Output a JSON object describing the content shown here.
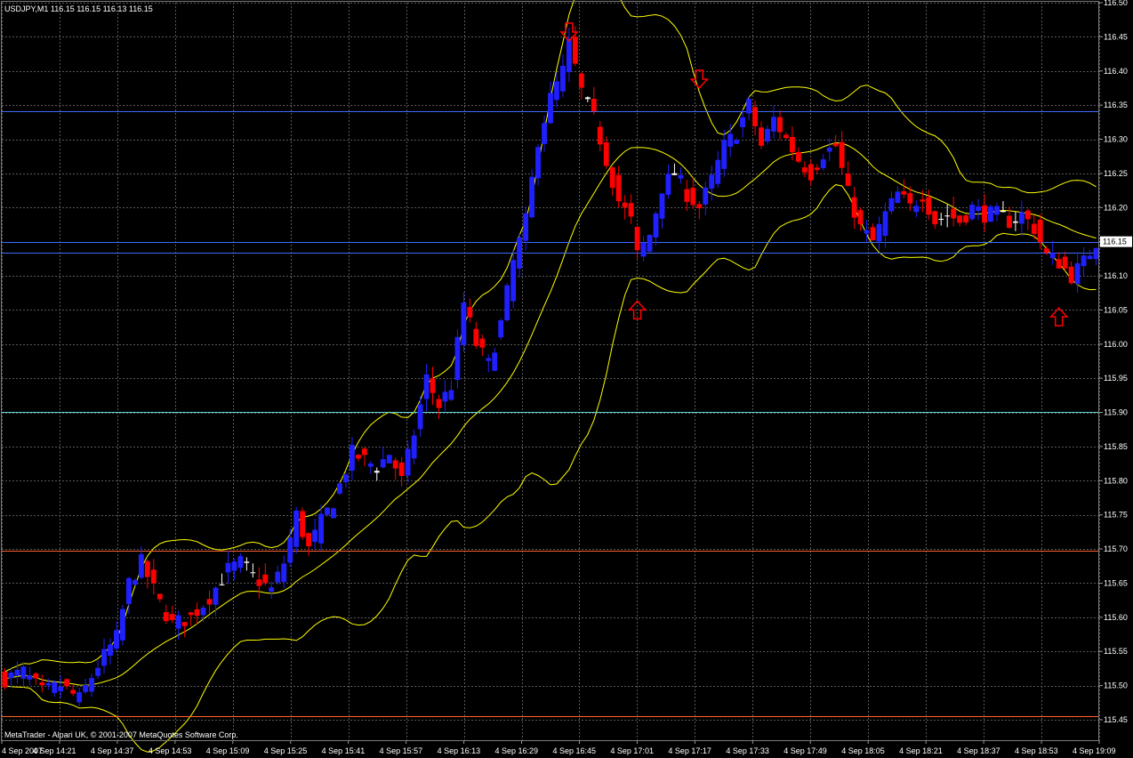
{
  "symbol_header": {
    "text": "USDJPY,M1  116.15 116.15 116.13 116.15"
  },
  "copyright": "MetaTrader - Alpari UK, © 2001-2007 MetaQuotes Software Corp.",
  "current_price_label": "116.15",
  "colors": {
    "background": "#000000",
    "grid": "#5a5a5a",
    "bull_candle": "#2020ff",
    "bear_candle": "#ff0000",
    "doji_candle": "#ffffff",
    "bollinger": "#ffff00",
    "blue_level": "#3d6cff",
    "cyan_level": "#5fd5d5",
    "orange_level": "#ff6030",
    "arrow": "#ff0000",
    "axis_text": "#ffffff"
  },
  "chart_data": {
    "type": "candlestick",
    "ylim": [
      115.42,
      116.5
    ],
    "y_ticks": [
      "116.50",
      "116.45",
      "116.40",
      "116.35",
      "116.30",
      "116.25",
      "116.20",
      "116.15",
      "116.10",
      "116.05",
      "116.00",
      "115.95",
      "115.90",
      "115.85",
      "115.80",
      "115.75",
      "115.70",
      "115.65",
      "115.60",
      "115.55",
      "115.50",
      "115.45"
    ],
    "x_ticks": [
      "4 Sep 2007",
      "4 Sep 14:21",
      "4 Sep 14:37",
      "4 Sep 14:53",
      "4 Sep 15:09",
      "4 Sep 15:25",
      "4 Sep 15:41",
      "4 Sep 15:57",
      "4 Sep 16:13",
      "4 Sep 16:29",
      "4 Sep 16:45",
      "4 Sep 17:01",
      "4 Sep 17:17",
      "4 Sep 17:33",
      "4 Sep 17:49",
      "4 Sep 18:05",
      "4 Sep 18:21",
      "4 Sep 18:37",
      "4 Sep 18:53",
      "4 Sep 19:09"
    ],
    "close_path": [
      [
        0,
        115.51
      ],
      [
        3,
        115.52
      ],
      [
        6,
        115.49
      ],
      [
        9,
        115.5
      ],
      [
        12,
        115.48
      ],
      [
        15,
        115.53
      ],
      [
        18,
        115.57
      ],
      [
        20,
        115.65
      ],
      [
        22,
        115.68
      ],
      [
        25,
        115.62
      ],
      [
        27,
        115.59
      ],
      [
        30,
        115.6
      ],
      [
        33,
        115.63
      ],
      [
        36,
        115.67
      ],
      [
        38,
        115.68
      ],
      [
        40,
        115.66
      ],
      [
        43,
        115.64
      ],
      [
        45,
        115.68
      ],
      [
        47,
        115.75
      ],
      [
        49,
        115.7
      ],
      [
        51,
        115.74
      ],
      [
        53,
        115.77
      ],
      [
        56,
        115.84
      ],
      [
        58,
        115.83
      ],
      [
        60,
        115.82
      ],
      [
        62,
        115.84
      ],
      [
        64,
        115.8
      ],
      [
        66,
        115.87
      ],
      [
        68,
        115.95
      ],
      [
        70,
        115.91
      ],
      [
        72,
        115.94
      ],
      [
        74,
        116.06
      ],
      [
        76,
        116.0
      ],
      [
        78,
        115.97
      ],
      [
        80,
        116.03
      ],
      [
        82,
        116.12
      ],
      [
        84,
        116.18
      ],
      [
        86,
        116.3
      ],
      [
        88,
        116.36
      ],
      [
        90,
        116.4
      ],
      [
        91,
        116.44
      ],
      [
        93,
        116.37
      ],
      [
        95,
        116.33
      ],
      [
        97,
        116.27
      ],
      [
        99,
        116.21
      ],
      [
        101,
        116.18
      ],
      [
        102,
        116.13
      ],
      [
        104,
        116.16
      ],
      [
        106,
        116.23
      ],
      [
        108,
        116.25
      ],
      [
        110,
        116.22
      ],
      [
        112,
        116.2
      ],
      [
        114,
        116.24
      ],
      [
        116,
        116.29
      ],
      [
        118,
        116.31
      ],
      [
        120,
        116.35
      ],
      [
        122,
        116.29
      ],
      [
        124,
        116.33
      ],
      [
        126,
        116.3
      ],
      [
        128,
        116.27
      ],
      [
        130,
        116.25
      ],
      [
        132,
        116.28
      ],
      [
        134,
        116.29
      ],
      [
        136,
        116.22
      ],
      [
        138,
        116.17
      ],
      [
        140,
        116.15
      ],
      [
        142,
        116.19
      ],
      [
        144,
        116.22
      ],
      [
        146,
        116.2
      ],
      [
        148,
        116.22
      ],
      [
        150,
        116.18
      ],
      [
        152,
        116.19
      ],
      [
        154,
        116.18
      ],
      [
        156,
        116.2
      ],
      [
        158,
        116.19
      ],
      [
        160,
        116.19
      ],
      [
        162,
        116.18
      ],
      [
        164,
        116.19
      ],
      [
        166,
        116.17
      ],
      [
        168,
        116.13
      ],
      [
        170,
        116.12
      ],
      [
        172,
        116.1
      ],
      [
        174,
        116.12
      ],
      [
        176,
        116.15
      ]
    ],
    "horizontal_levels": [
      {
        "price": 116.341,
        "color_key": "blue_level"
      },
      {
        "price": 116.15,
        "color_key": "blue_level"
      },
      {
        "price": 116.134,
        "color_key": "blue_level"
      },
      {
        "price": 115.901,
        "color_key": "cyan_level"
      },
      {
        "price": 115.697,
        "color_key": "orange_level"
      },
      {
        "price": 115.455,
        "color_key": "orange_level"
      }
    ],
    "arrow_markers": [
      {
        "bar": 91,
        "price": 116.457,
        "dir": "down"
      },
      {
        "bar": 112,
        "price": 116.388,
        "dir": "down"
      },
      {
        "bar": 102,
        "price": 116.05,
        "dir": "up"
      },
      {
        "bar": 170,
        "price": 116.04,
        "dir": "up"
      }
    ]
  }
}
